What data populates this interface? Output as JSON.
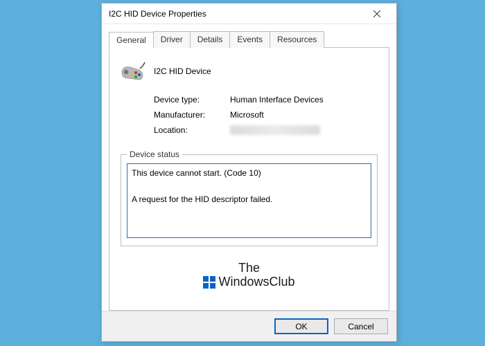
{
  "dialog": {
    "title": "I2C HID Device Properties",
    "tabs": [
      "General",
      "Driver",
      "Details",
      "Events",
      "Resources"
    ],
    "active_tab": 0
  },
  "general": {
    "device_name": "I2C HID Device",
    "rows": {
      "device_type_label": "Device type:",
      "device_type_value": "Human Interface Devices",
      "manufacturer_label": "Manufacturer:",
      "manufacturer_value": "Microsoft",
      "location_label": "Location:"
    },
    "device_status_label": "Device status",
    "status_text": "This device cannot start. (Code 10)\n\nA request for the HID descriptor failed."
  },
  "buttons": {
    "ok": "OK",
    "cancel": "Cancel"
  },
  "watermark": {
    "line1": "The",
    "line2": "WindowsClub"
  }
}
